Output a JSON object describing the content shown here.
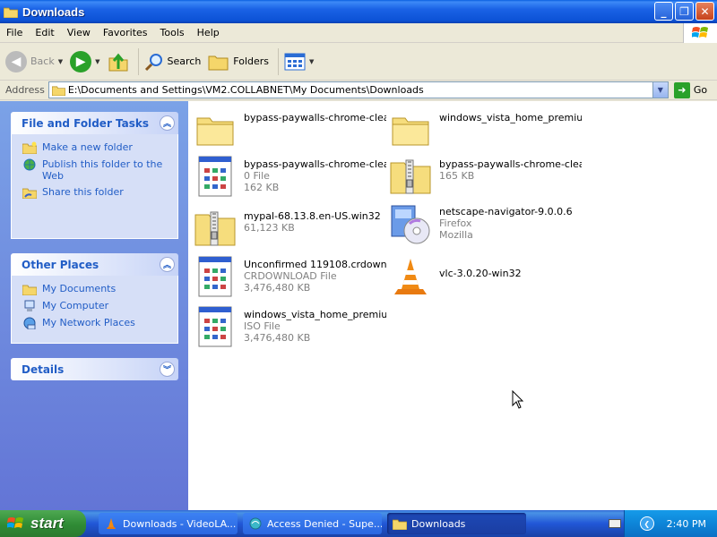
{
  "window": {
    "title": "Downloads",
    "buttons": {
      "minimize": "_",
      "maximize": "❐",
      "close": "✕"
    }
  },
  "menu": [
    "File",
    "Edit",
    "View",
    "Favorites",
    "Tools",
    "Help"
  ],
  "toolbar": {
    "back_label": "Back",
    "search_label": "Search",
    "folders_label": "Folders"
  },
  "address": {
    "label": "Address",
    "value": "E:\\Documents and Settings\\VM2.COLLABNET\\My Documents\\Downloads",
    "go_label": "Go"
  },
  "tasks_panel": {
    "title": "File and Folder Tasks",
    "items": [
      "Make a new folder",
      "Publish this folder to the Web",
      "Share this folder"
    ]
  },
  "places_panel": {
    "title": "Other Places",
    "items": [
      "My Documents",
      "My Computer",
      "My Network Places"
    ]
  },
  "details_panel": {
    "title": "Details"
  },
  "files": [
    {
      "name": "bypass-paywalls-chrome-clea...",
      "type": "folder"
    },
    {
      "name": "windows_vista_home_premiu...",
      "type": "folder"
    },
    {
      "name": "bypass-paywalls-chrome-clea...",
      "line2": "0 File",
      "line3": "162 KB",
      "type": "file"
    },
    {
      "name": "bypass-paywalls-chrome-clea...",
      "line2": "165 KB",
      "type": "zip"
    },
    {
      "name": "mypal-68.13.8.en-US.win32",
      "line2": "61,123 KB",
      "type": "zip"
    },
    {
      "name": "netscape-navigator-9.0.0.6",
      "line2": "Firefox",
      "line3": "Mozilla",
      "type": "installer"
    },
    {
      "name": "Unconfirmed 119108.crdownload",
      "line2": "CRDOWNLOAD File",
      "line3": "3,476,480 KB",
      "type": "file"
    },
    {
      "name": "vlc-3.0.20-win32",
      "type": "vlc"
    },
    {
      "name": "windows_vista_home_premiu...",
      "line2": "ISO File",
      "line3": "3,476,480 KB",
      "type": "file"
    }
  ],
  "taskbar": {
    "start_label": "start",
    "buttons": [
      "Downloads - VideoLA...",
      "Access Denied - Supe...",
      "Downloads"
    ],
    "clock": "2:40 PM"
  },
  "colors": {
    "titlebar": "#0c52d6",
    "taskpane": "#6f8cde",
    "link": "#215dc6",
    "start": "#2f8b35"
  }
}
